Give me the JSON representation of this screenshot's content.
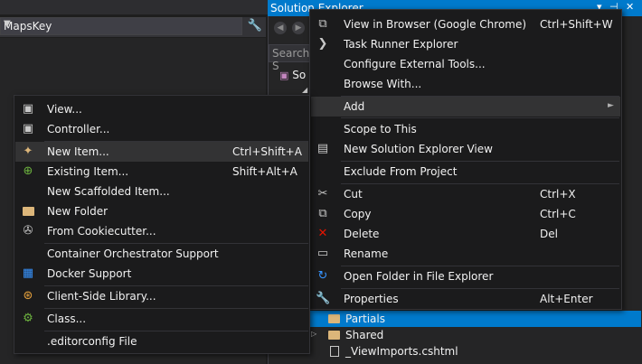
{
  "properties": {
    "combo_value": "MapsKey"
  },
  "solution_explorer": {
    "title": "Solution Explorer",
    "search_placeholder": "Search S",
    "tree_solution": "So",
    "tree_items": [
      {
        "label": "Partials",
        "selected": true,
        "icon": "folder-icon"
      },
      {
        "label": "Shared",
        "selected": false,
        "icon": "folder-icon"
      },
      {
        "label": "_ViewImports.cshtml",
        "selected": false,
        "icon": "file-icon"
      }
    ]
  },
  "context_menu": {
    "items": [
      {
        "label": "View in Browser (Google Chrome)",
        "shortcut": "Ctrl+Shift+W",
        "icon": "browser-icon"
      },
      {
        "label": "Task Runner Explorer",
        "shortcut": "",
        "icon": "chevron-right-icon"
      },
      {
        "label": "Configure External Tools...",
        "shortcut": "",
        "icon": ""
      },
      {
        "label": "Browse With...",
        "shortcut": "",
        "icon": ""
      },
      {
        "label": "Add",
        "shortcut": "",
        "icon": ""
      },
      {
        "label": "Scope to This",
        "shortcut": "",
        "icon": ""
      },
      {
        "label": "New Solution Explorer View",
        "shortcut": "",
        "icon": "new-view-icon"
      },
      {
        "label": "Exclude From Project",
        "shortcut": "",
        "icon": ""
      },
      {
        "label": "Cut",
        "shortcut": "Ctrl+X",
        "icon": "scissors-icon"
      },
      {
        "label": "Copy",
        "shortcut": "Ctrl+C",
        "icon": "copy-icon"
      },
      {
        "label": "Delete",
        "shortcut": "Del",
        "icon": "delete-x-icon"
      },
      {
        "label": "Rename",
        "shortcut": "",
        "icon": "rename-icon"
      },
      {
        "label": "Open Folder in File Explorer",
        "shortcut": "",
        "icon": "refresh-arrow-icon"
      },
      {
        "label": "Properties",
        "shortcut": "Alt+Enter",
        "icon": "wrench-icon"
      }
    ]
  },
  "add_submenu": {
    "items": [
      {
        "label": "View...",
        "shortcut": "",
        "icon": "view-file-icon"
      },
      {
        "label": "Controller...",
        "shortcut": "",
        "icon": "controller-file-icon"
      },
      {
        "label": "New Item...",
        "shortcut": "Ctrl+Shift+A",
        "icon": "new-item-icon"
      },
      {
        "label": "Existing Item...",
        "shortcut": "Shift+Alt+A",
        "icon": "existing-item-icon"
      },
      {
        "label": "New Scaffolded Item...",
        "shortcut": "",
        "icon": ""
      },
      {
        "label": "New Folder",
        "shortcut": "",
        "icon": "new-folder-icon"
      },
      {
        "label": "From Cookiecutter...",
        "shortcut": "",
        "icon": "cookiecutter-icon"
      },
      {
        "label": "Container Orchestrator Support",
        "shortcut": "",
        "icon": ""
      },
      {
        "label": "Docker Support",
        "shortcut": "",
        "icon": "docker-icon"
      },
      {
        "label": "Client-Side Library...",
        "shortcut": "",
        "icon": "library-icon"
      },
      {
        "label": "Class...",
        "shortcut": "",
        "icon": "class-icon"
      },
      {
        "label": ".editorconfig File",
        "shortcut": "",
        "icon": ""
      }
    ]
  }
}
